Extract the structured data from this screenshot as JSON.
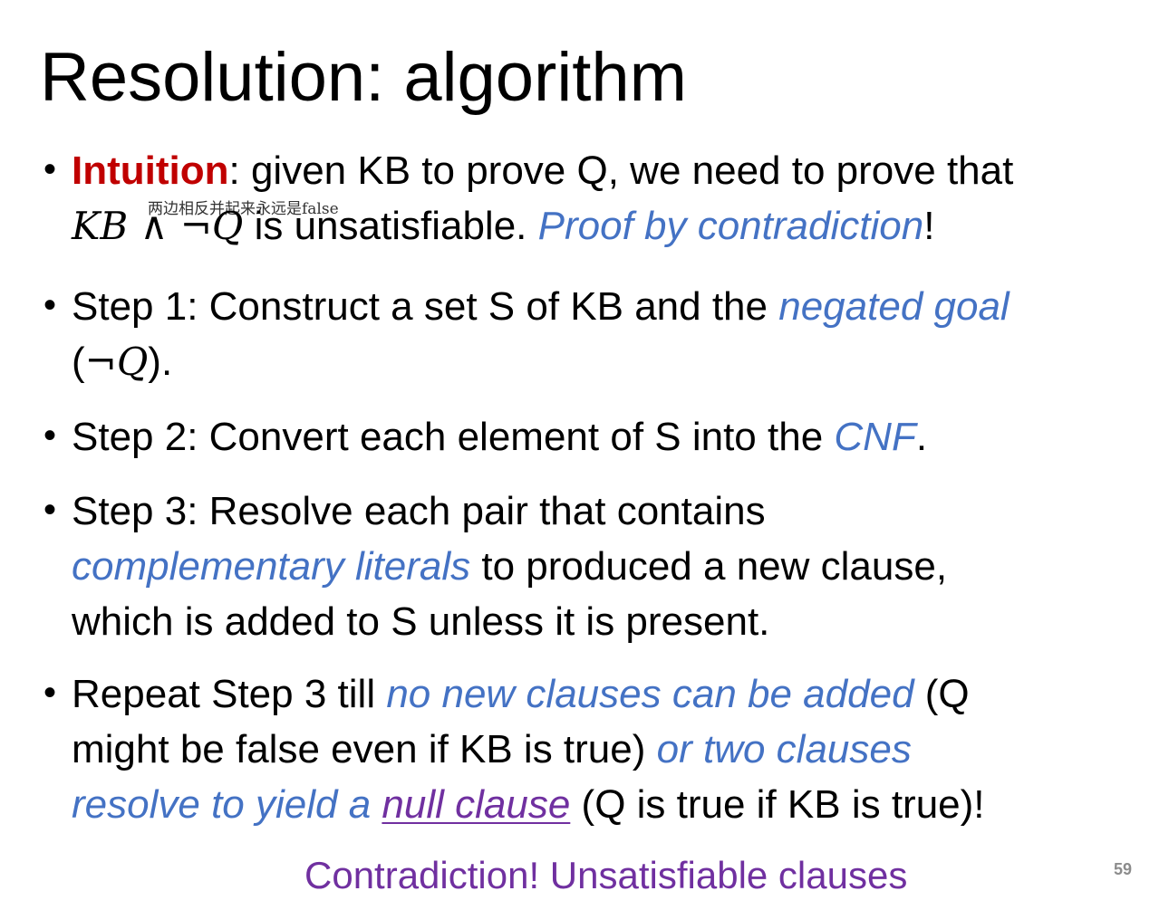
{
  "slide": {
    "title": "Resolution: algorithm",
    "annotation": "两边相反并起来永远是false",
    "bullets": {
      "b1": {
        "term": "Intuition",
        "text1": ": given KB to prove Q, we need to prove that",
        "math_kb": "KB",
        "math_and": " ∧ ",
        "math_not": "¬",
        "math_q": "Q",
        "text2": " is unsatisfiable. ",
        "emph": "Proof by contradiction",
        "text3": "!"
      },
      "b2": {
        "text1": "Step 1: Construct a set S of KB and the ",
        "emph": "negated goal",
        "paren_open": "(",
        "math_not": "¬",
        "math_q": "Q",
        "paren_close": ")."
      },
      "b3": {
        "text1": "Step 2: Convert each element of S into the ",
        "emph": "CNF",
        "text2": "."
      },
      "b4": {
        "line1": "Step 3: Resolve each pair that contains",
        "emph": "complementary literals",
        "text2": " to produced a new clause,",
        "line3": "which is added to S unless it is present."
      },
      "b5": {
        "text1": "Repeat Step 3 till ",
        "emph1": "no new clauses can be added",
        "text2": " (Q",
        "line2_text": "might be false even if KB is true) ",
        "emph2": "or two clauses",
        "emph3": "resolve to yield a ",
        "underline": "null clause",
        "text3": " (Q is true if KB is true)!"
      }
    },
    "footer": "Contradiction! Unsatisfiable clauses",
    "page_number": "59"
  }
}
